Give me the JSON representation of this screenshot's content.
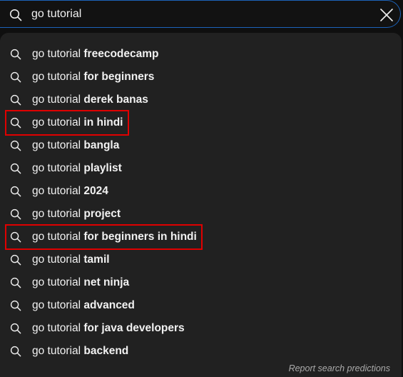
{
  "search": {
    "value": "go tutorial",
    "placeholder": "Search"
  },
  "suggestions": [
    {
      "prefix": "go tutorial ",
      "suffix": "freecodecamp",
      "highlighted": false
    },
    {
      "prefix": "go tutorial ",
      "suffix": "for beginners",
      "highlighted": false
    },
    {
      "prefix": "go tutorial ",
      "suffix": "derek banas",
      "highlighted": false
    },
    {
      "prefix": "go tutorial ",
      "suffix": "in hindi",
      "highlighted": true
    },
    {
      "prefix": "go tutorial ",
      "suffix": "bangla",
      "highlighted": false
    },
    {
      "prefix": "go tutorial ",
      "suffix": "playlist",
      "highlighted": false
    },
    {
      "prefix": "go tutorial ",
      "suffix": "2024",
      "highlighted": false
    },
    {
      "prefix": "go tutorial ",
      "suffix": "project",
      "highlighted": false
    },
    {
      "prefix": "go tutorial ",
      "suffix": "for beginners in hindi",
      "highlighted": true
    },
    {
      "prefix": "go tutorial ",
      "suffix": "tamil",
      "highlighted": false
    },
    {
      "prefix": "go tutorial ",
      "suffix": "net ninja",
      "highlighted": false
    },
    {
      "prefix": "go tutorial ",
      "suffix": "advanced",
      "highlighted": false
    },
    {
      "prefix": "go tutorial ",
      "suffix": "for java developers",
      "highlighted": false
    },
    {
      "prefix": "go tutorial ",
      "suffix": "backend",
      "highlighted": false
    }
  ],
  "footer": {
    "report_label": "Report search predictions"
  },
  "icons": {
    "search": "search-icon",
    "clear": "close-icon"
  },
  "colors": {
    "focus_border": "#1c62b9",
    "highlight_box": "#e00000",
    "dropdown_bg": "#212121"
  }
}
